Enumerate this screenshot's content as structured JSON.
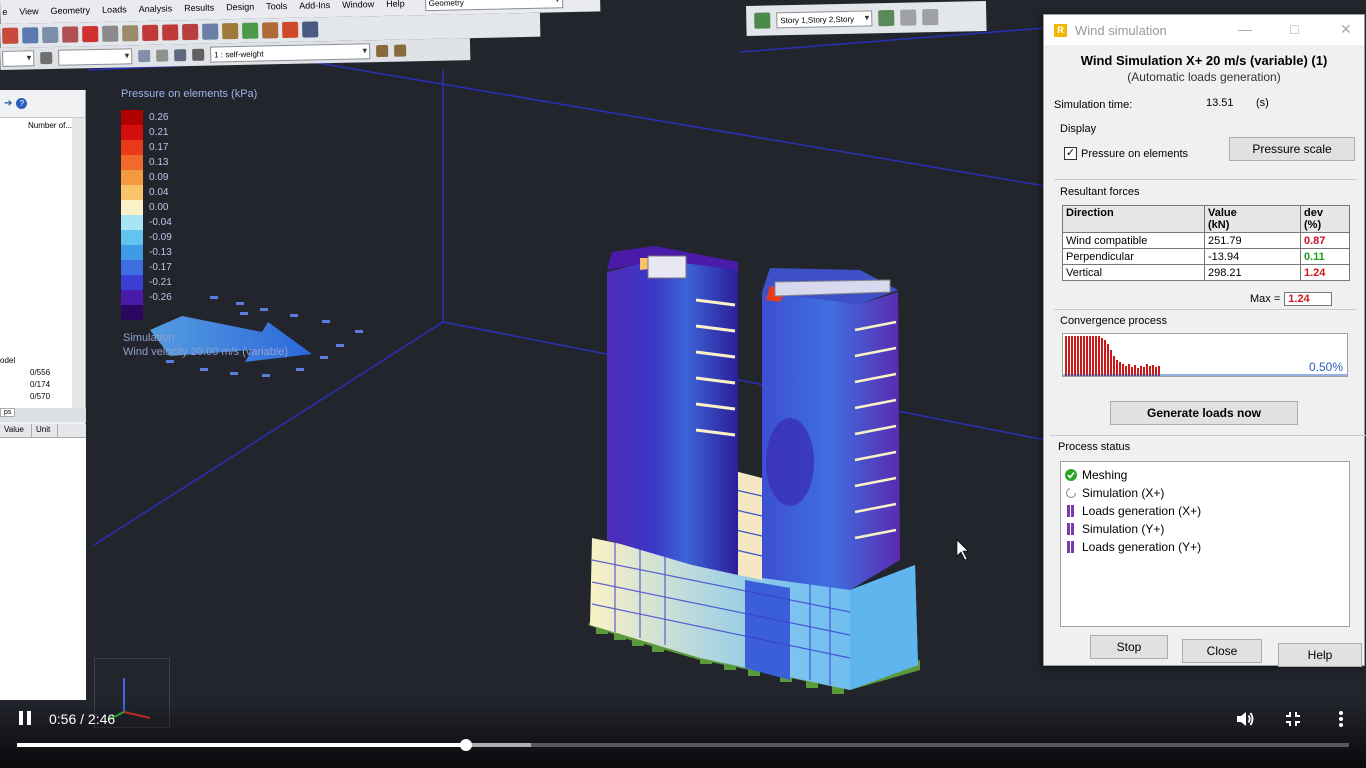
{
  "menu": {
    "items": [
      "e",
      "View",
      "Geometry",
      "Loads",
      "Analysis",
      "Results",
      "Design",
      "Tools",
      "Add-Ins",
      "Window",
      "Help"
    ],
    "layout_combo": "Geometry"
  },
  "toolbar": {
    "load_case_combo": "1 : self-weight",
    "story_combo": "Story 1,Story 2,Story"
  },
  "left_panel": {
    "tree_header": "Number of...",
    "tree_label": "odel",
    "tree_counts": [
      "0/556",
      "0/174",
      "0/570"
    ],
    "tab_label": "ps",
    "grid_headers": [
      "Value",
      "Unit"
    ]
  },
  "viewport": {
    "legend_title": "Pressure on elements (kPa)",
    "legend": [
      {
        "value": "0.26",
        "color": "#b00000"
      },
      {
        "value": "0.21",
        "color": "#d40d0d"
      },
      {
        "value": "0.17",
        "color": "#e8391a"
      },
      {
        "value": "0.13",
        "color": "#ef6a2c"
      },
      {
        "value": "0.09",
        "color": "#f39a3e"
      },
      {
        "value": "0.04",
        "color": "#f7c46a"
      },
      {
        "value": "0.00",
        "color": "#fbf1c6"
      },
      {
        "value": "-0.04",
        "color": "#a9e4f4"
      },
      {
        "value": "-0.09",
        "color": "#62c5ef"
      },
      {
        "value": "-0.13",
        "color": "#3f9be8"
      },
      {
        "value": "-0.17",
        "color": "#3e6ee0"
      },
      {
        "value": "-0.21",
        "color": "#3b3ed2"
      },
      {
        "value": "-0.26",
        "color": "#4a1aa8"
      },
      {
        "value": "",
        "color": "#2a0860"
      }
    ],
    "sim_label": "Simulation",
    "wind_velocity": "Wind velocity 20.00 m/s  (variable)"
  },
  "dialog": {
    "window_title": "Wind simulation",
    "logo": "R",
    "heading": "Wind Simulation X+ 20 m/s (variable) (1)",
    "subheading": "(Automatic loads generation)",
    "sim_time_label": "Simulation time:",
    "sim_time_value": "13.51",
    "sim_time_unit": "(s)",
    "display_label": "Display",
    "pressure_checkbox": "Pressure on elements",
    "pressure_checked": true,
    "pressure_scale_button": "Pressure scale",
    "forces_label": "Resultant forces",
    "forces_headers": [
      "Direction",
      "Value\n(kN)",
      "dev\n(%)"
    ],
    "forces_rows": [
      {
        "direction": "Wind compatible",
        "value": "251.79",
        "dev": "0.87",
        "dev_color": "#c8102e"
      },
      {
        "direction": "Perpendicular",
        "value": "-13.94",
        "dev": "0.11",
        "dev_color": "#1aa31a"
      },
      {
        "direction": "Vertical",
        "value": "298.21",
        "dev": "1.24",
        "dev_color": "#d01818"
      }
    ],
    "max_label": "Max =",
    "max_value": "1.24",
    "convergence_label": "Convergence process",
    "convergence_percent": "0.50%",
    "generate_button": "Generate loads now",
    "process_status_label": "Process status",
    "process_items": [
      {
        "label": "Meshing",
        "state": "done"
      },
      {
        "label": "Simulation (X+)",
        "state": "running"
      },
      {
        "label": "Loads generation (X+)",
        "state": "pending"
      },
      {
        "label": "Simulation (Y+)",
        "state": "pending"
      },
      {
        "label": "Loads generation (Y+)",
        "state": "pending"
      }
    ],
    "stop_button": "Stop",
    "close_button": "Close",
    "help_button": "Help"
  },
  "player": {
    "time": "0:56 / 2:46",
    "progress_fraction": 0.337,
    "buffered_fraction": 0.386
  }
}
